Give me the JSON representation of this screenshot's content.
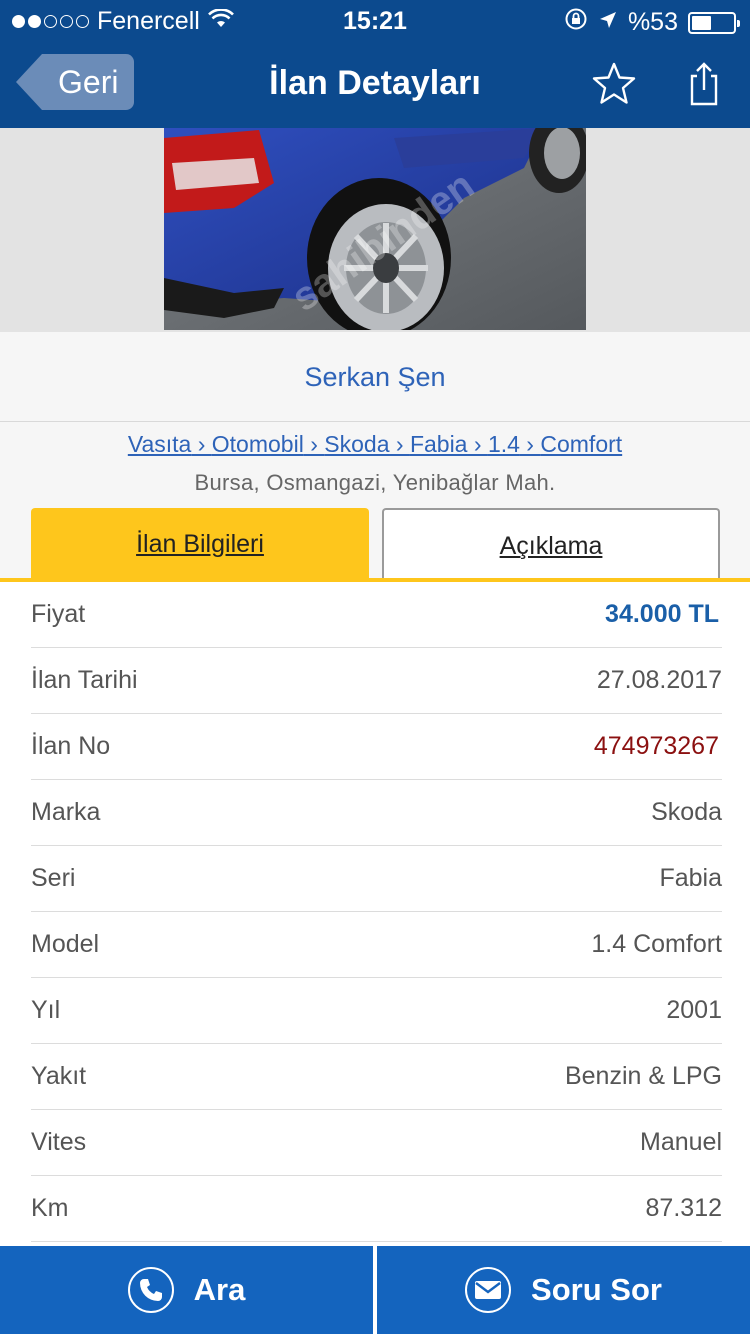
{
  "status_bar": {
    "carrier": "Fenercell",
    "time": "15:21",
    "battery": "%53",
    "battery_level": 0.53,
    "signal_bars_filled": 2,
    "signal_bars_total": 5
  },
  "nav": {
    "back_label": "Geri",
    "title": "İlan Detayları",
    "favorite_icon": "star-outline-icon",
    "share_icon": "share-icon"
  },
  "photo": {
    "watermark": "sahibinden"
  },
  "seller": {
    "name": "Serkan Şen"
  },
  "breadcrumb": [
    "Vasıta",
    "Otomobil",
    "Skoda",
    "Fabia",
    "1.4",
    "Comfort"
  ],
  "location": "Bursa, Osmangazi, Yenibağlar Mah.",
  "tabs": {
    "active": "İlan Bilgileri",
    "inactive": "Açıklama"
  },
  "details": [
    {
      "label": "Fiyat",
      "value": "34.000 TL"
    },
    {
      "label": "İlan Tarihi",
      "value": "27.08.2017"
    },
    {
      "label": "İlan No",
      "value": "474973267"
    },
    {
      "label": "Marka",
      "value": "Skoda"
    },
    {
      "label": "Seri",
      "value": "Fabia"
    },
    {
      "label": "Model",
      "value": "1.4 Comfort"
    },
    {
      "label": "Yıl",
      "value": "2001"
    },
    {
      "label": "Yakıt",
      "value": "Benzin & LPG"
    },
    {
      "label": "Vites",
      "value": "Manuel"
    },
    {
      "label": "Km",
      "value": "87.312"
    }
  ],
  "bottom_bar": {
    "call_label": "Ara",
    "call_icon": "phone-icon",
    "message_label": "Soru Sor",
    "message_icon": "envelope-icon"
  },
  "colors": {
    "header_blue": "#0c4a8e",
    "bottom_blue": "#1464be",
    "accent_yellow": "#fec61c",
    "link_blue": "#2e63b8",
    "price_blue": "#1a5fa8",
    "adno_red": "#8b1010"
  }
}
